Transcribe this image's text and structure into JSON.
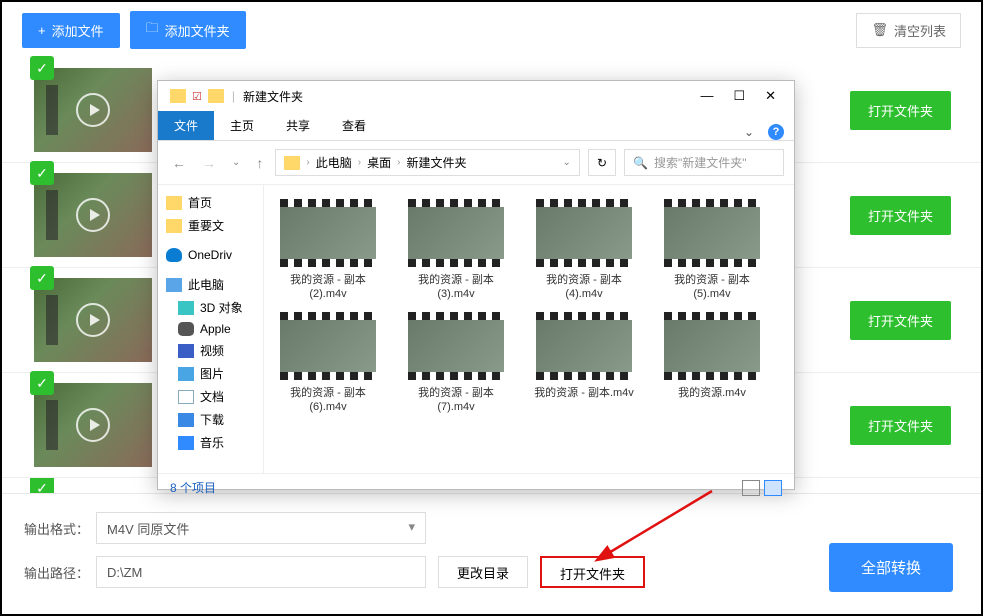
{
  "toolbar": {
    "add_file": "添加文件",
    "add_folder": "添加文件夹",
    "clear_list": "清空列表"
  },
  "list": {
    "open_folder": "打开文件夹"
  },
  "bottom": {
    "format_label": "输出格式：",
    "format_value": "M4V  同原文件",
    "path_label": "输出路径：",
    "path_value": "D:\\ZM",
    "change_dir": "更改目录",
    "open_folder": "打开文件夹",
    "convert_all": "全部转换"
  },
  "dialog": {
    "title": "新建文件夹",
    "tabs": {
      "file": "文件",
      "home": "主页",
      "share": "共享",
      "view": "查看"
    },
    "breadcrumb": {
      "pc": "此电脑",
      "desktop": "桌面",
      "folder": "新建文件夹"
    },
    "search_placeholder": "搜索\"新建文件夹\"",
    "sidebar": {
      "home": "首页",
      "important": "重要文",
      "onedrive": "OneDriv",
      "pc": "此电脑",
      "3d": "3D 对象",
      "apple": "Apple",
      "video": "视频",
      "pictures": "图片",
      "docs": "文档",
      "downloads": "下载",
      "music": "音乐"
    },
    "files": [
      "我的资源 - 副本 (2).m4v",
      "我的资源 - 副本 (3).m4v",
      "我的资源 - 副本 (4).m4v",
      "我的资源 - 副本 (5).m4v",
      "我的资源 - 副本 (6).m4v",
      "我的资源 - 副本 (7).m4v",
      "我的资源 - 副本.m4v",
      "我的资源.m4v"
    ],
    "status": "8 个项目"
  }
}
